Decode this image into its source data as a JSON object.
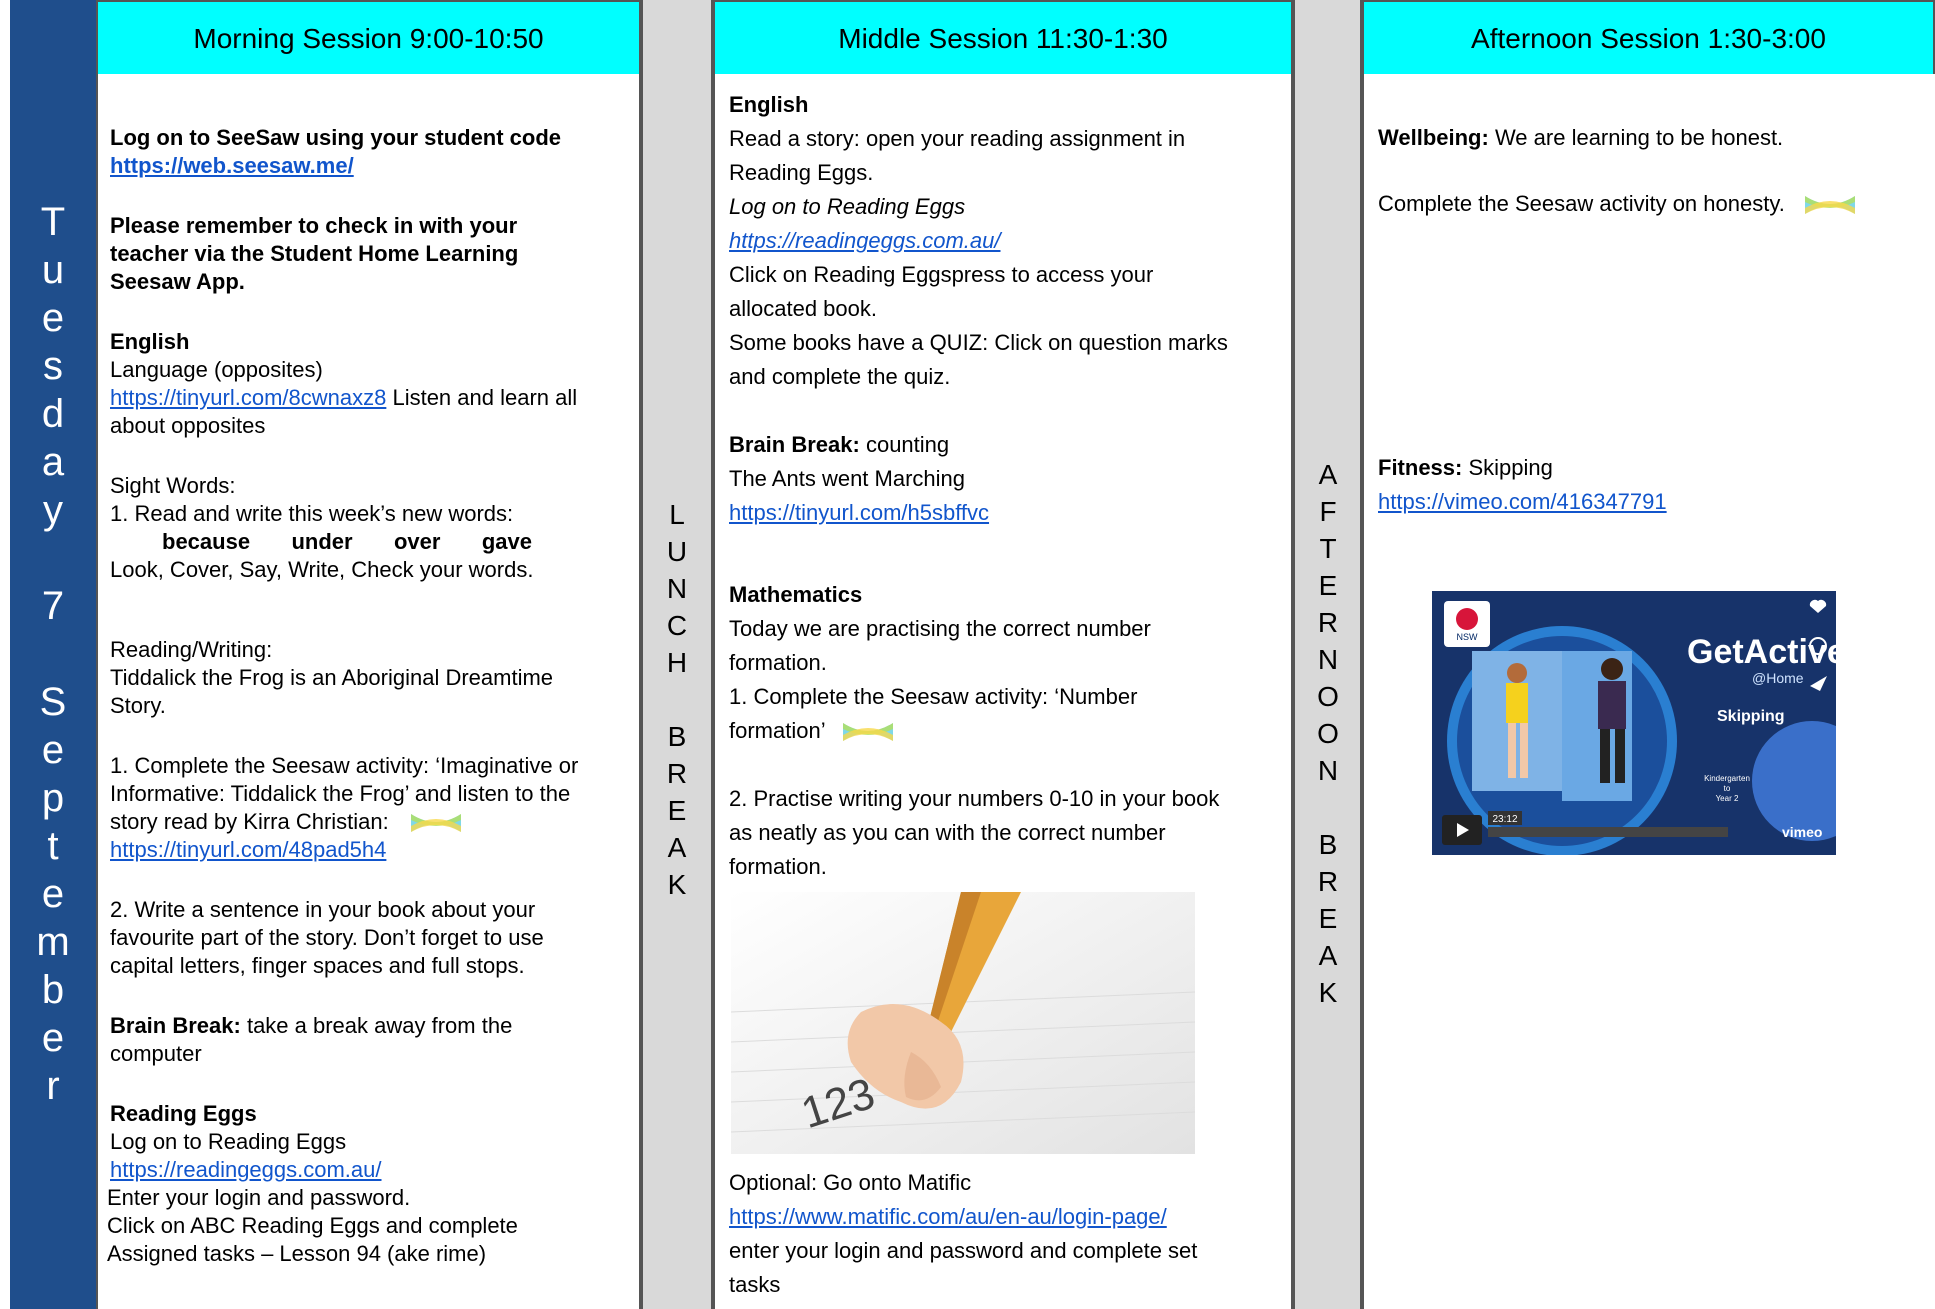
{
  "day_column": {
    "letters": [
      "T",
      "u",
      "e",
      "s",
      "d",
      "a",
      "y",
      "",
      "7",
      "",
      "S",
      "e",
      "p",
      "t",
      "e",
      "m",
      "b",
      "e",
      "r"
    ]
  },
  "lunch_break": {
    "letters": [
      "L",
      "U",
      "N",
      "C",
      "H",
      "",
      "B",
      "R",
      "E",
      "A",
      "K"
    ]
  },
  "afternoon_break": {
    "letters": [
      "A",
      "F",
      "T",
      "E",
      "R",
      "N",
      "O",
      "O",
      "N",
      "",
      "B",
      "R",
      "E",
      "A",
      "K"
    ]
  },
  "headers": {
    "morning": "Morning Session 9:00-10:50",
    "middle": "Middle Session    11:30-1:30",
    "afternoon": "Afternoon Session  1:30-3:00"
  },
  "morning": {
    "logon": "Log on to SeeSaw using your student code",
    "logon_link": "https://web.seesaw.me/",
    "remember_1": "Please remember to check in with your",
    "remember_2": "teacher via the Student Home Learning",
    "remember_3": "Seesaw App.",
    "english_title": "English",
    "language": "Language (opposites)",
    "language_link": "https://tinyurl.com/8cwnaxz8",
    "language_rest": " Listen and learn all",
    "language_2": "about opposites",
    "sight_title": "Sight Words:",
    "sight_1": "1. Read and write this week’s new words:",
    "words": [
      "because",
      "under",
      "over",
      "gave"
    ],
    "sight_2": "Look, Cover, Say, Write, Check your words.",
    "rw_title": "Reading/Writing:",
    "rw_1": "Tiddalick the Frog is an Aboriginal Dreamtime",
    "rw_2": "Story.",
    "rw_3": "1. Complete the Seesaw activity: ‘Imaginative or",
    "rw_4": "Informative: Tiddalick the Frog’ and listen to the",
    "rw_5": "story read by Kirra Christian:",
    "rw_link": "https://tinyurl.com/48pad5h4",
    "rw_6": "2. Write a sentence in your book about your",
    "rw_7": "favourite part of the story. Don’t forget to use",
    "rw_8": "capital letters, finger spaces and full stops.",
    "bb_label": "Brain Break:",
    "bb_text": " take a break away from the",
    "bb_2": "computer",
    "re_title": "Reading Eggs",
    "re_1": "Log on to Reading Eggs",
    "re_link": "https://readingeggs.com.au/",
    "re_2": "Enter your login and password.",
    "re_3": "Click on ABC Reading Eggs and complete",
    "re_4": "Assigned tasks – Lesson 94 (ake rime)"
  },
  "middle": {
    "english_title": "English",
    "l1": "Read a story: open your reading assignment in",
    "l2": "Reading Eggs.",
    "l3": "Log on to Reading Eggs",
    "link1": "https://readingeggs.com.au/",
    "l4": "Click on Reading Eggspress to access your",
    "l5": "allocated book.",
    "l6": "Some books have a QUIZ: Click on question marks",
    "l7": "and complete the quiz.",
    "bb_label": "Brain Break:",
    "bb_text": " counting",
    "bb_2": "The Ants went Marching",
    "bb_link": "https://tinyurl.com/h5sbffvc",
    "math_title": "Mathematics",
    "m1": "Today we are practising the correct number",
    "m2": "formation.",
    "m3": "1. Complete the Seesaw activity: ‘Number",
    "m4": "formation’",
    "m5": "2. Practise writing your numbers 0-10 in your book",
    "m6": "as neatly as you can with the correct number",
    "m7": "formation.",
    "handwriting": "123",
    "opt": "Optional: Go onto Matific",
    "opt_link": "https://www.matific.com/au/en-au/login-page/",
    "opt_2": "enter your login and password and complete set",
    "opt_3": "tasks"
  },
  "afternoon": {
    "wb_label": "Wellbeing:",
    "wb_text": " We are learning to be honest.",
    "wb_2": "Complete the Seesaw activity on honesty.",
    "fit_label": "Fitness:",
    "fit_text": " Skipping",
    "fit_link": "https://vimeo.com/416347791",
    "video": {
      "logo": "NSW",
      "brand": "GetActive",
      "brand_sub": "@Home",
      "topic": "Skipping",
      "grade_1": "Kindergarten",
      "grade_2": "to",
      "grade_3": "Year 2",
      "time": "23:12",
      "vimeo": "vimeo"
    }
  }
}
